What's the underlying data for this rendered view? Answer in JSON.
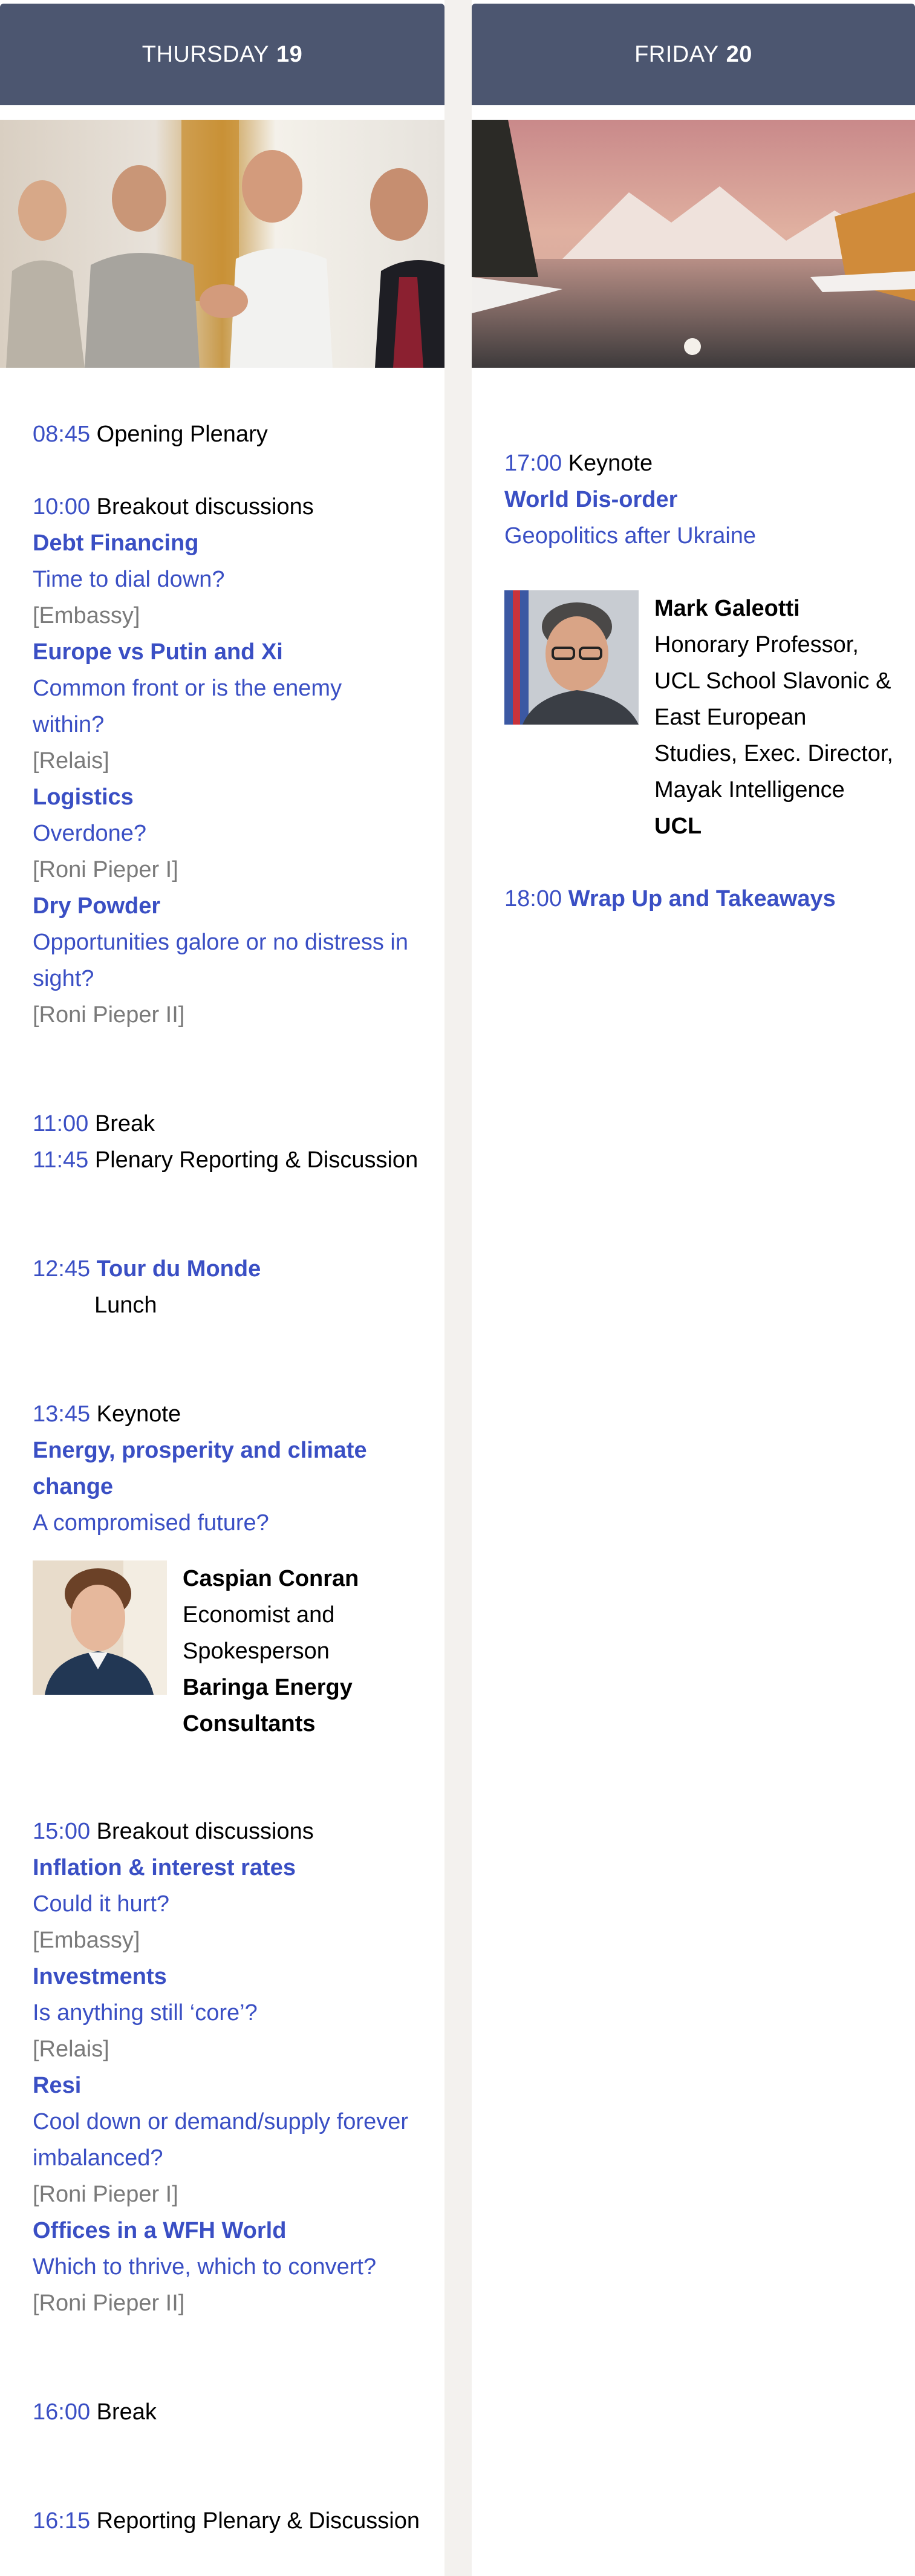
{
  "thursday": {
    "header": {
      "day": "THURSDAY",
      "num": "19"
    },
    "items": {
      "plenary": {
        "time": "08:45",
        "label": "Opening Plenary"
      },
      "breakout1": {
        "time": "10:00",
        "label": "Breakout discussions",
        "sessions": [
          {
            "title": "Debt Financing",
            "sub": "Time to dial down?",
            "room": "[Embassy]"
          },
          {
            "title": "Europe vs Putin and Xi",
            "sub1": "Common front or is the enemy",
            "sub2": "within?",
            "room": "[Relais]"
          },
          {
            "title": "Logistics",
            "sub": "Overdone?",
            "room": "[Roni Pieper I]"
          },
          {
            "title": "Dry Powder",
            "sub1": "Opportunities galore or no distress in",
            "sub2": "sight?",
            "room": "[Roni Pieper II]"
          }
        ]
      },
      "break1": {
        "time": "11:00",
        "label": "Break"
      },
      "reporting": {
        "time": "11:45",
        "label": "Plenary Reporting & Discussion"
      },
      "tour": {
        "time": "12:45",
        "label": "Tour du Monde",
        "sub": "Lunch"
      },
      "keynote": {
        "time": "13:45",
        "label": "Keynote",
        "title1": "Energy, prosperity and climate",
        "title2": "change",
        "sub": "A compromised future?",
        "speaker": {
          "name": "Caspian Conran",
          "role1": "Economist and",
          "role2": "Spokesperson",
          "org1": "Baringa Energy",
          "org2": "Consultants"
        }
      },
      "breakout2": {
        "time": "15:00",
        "label": "Breakout discussions",
        "sessions": [
          {
            "title": "Inflation & interest rates",
            "sub": "Could it hurt?",
            "room": "[Embassy]"
          },
          {
            "title": "Investments",
            "sub": "Is anything still ‘core’?",
            "room": "[Relais]"
          },
          {
            "title": "Resi",
            "sub1": "Cool down or demand/supply forever",
            "sub2": "imbalanced?",
            "room": "[Roni Pieper I]"
          },
          {
            "title": "Offices in a WFH World",
            "sub": "Which to thrive, which to convert?",
            "room": "[Roni Pieper II]"
          }
        ]
      },
      "break2": {
        "time": "16:00",
        "label": "Break"
      },
      "final": {
        "time": "16:15",
        "label": "Reporting Plenary & Discussion"
      }
    }
  },
  "friday": {
    "header": {
      "day": "FRIDAY",
      "num": "20"
    },
    "keynote": {
      "time": "17:00",
      "label": "Keynote",
      "title": "World Dis-order",
      "sub": "Geopolitics after Ukraine",
      "speaker": {
        "name": "Mark Galeotti",
        "role1": "Honorary Professor,",
        "role2": "UCL School Slavonic &",
        "role3": "East European",
        "role4": "Studies, Exec. Director,",
        "role5": "Mayak Intelligence",
        "org": "UCL"
      }
    },
    "wrap": {
      "time": "18:00",
      "label": "Wrap Up and Takeaways"
    }
  },
  "colors": {
    "header": "#4c5670",
    "accent": "#3a4fc4",
    "room": "#7a7a7a",
    "gutter": "#f3f1ee"
  }
}
